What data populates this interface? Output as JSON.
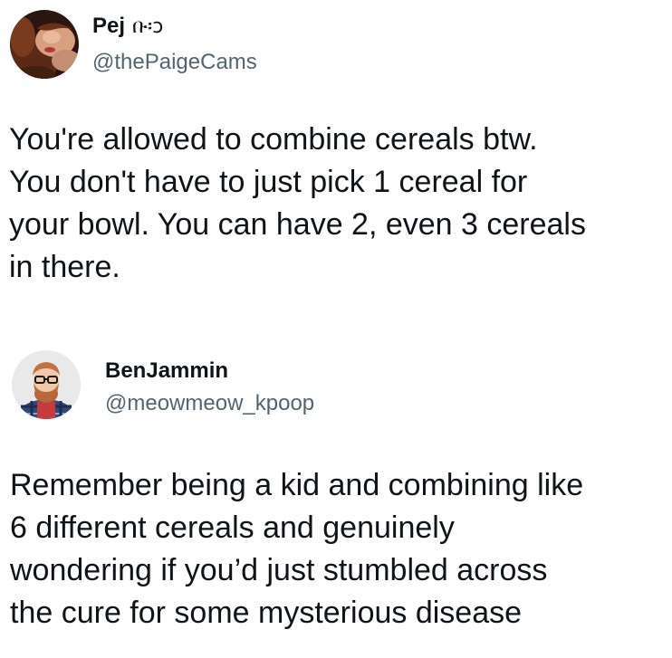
{
  "tweets": [
    {
      "display_name": "Pej",
      "name_emoji": "ቡ፡ↄ",
      "handle": "@thePaigeCams",
      "text": "You're allowed to combine cereals btw.\nYou don't have to just pick 1 cereal for\nyour bowl. You can have 2, even 3 cereals\nin there.",
      "avatar_icon": "profile-photo"
    },
    {
      "display_name": "BenJammin",
      "handle": "@meowmeow_kpoop",
      "text": "Remember being a kid and combining like\n6 different cereals and genuinely\nwondering if you’d just stumbled across\nthe cure for some mysterious disease",
      "avatar_icon": "profile-photo"
    }
  ],
  "colors": {
    "text": "#0f1419",
    "secondary": "#536471",
    "background": "#ffffff"
  }
}
